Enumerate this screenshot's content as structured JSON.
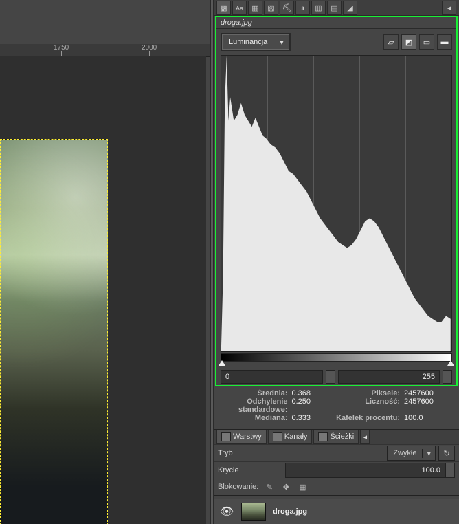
{
  "file": {
    "name": "droga.jpg"
  },
  "ruler": {
    "ticks": [
      "1750",
      "2000"
    ]
  },
  "top_tabs": [
    "brush",
    "text",
    "pattern",
    "gradient",
    "tool",
    "mask",
    "grid",
    "filter",
    "histogram"
  ],
  "histogram": {
    "channel_label": "Luminancja",
    "range_min": "0",
    "range_max": "255",
    "stats": {
      "mean_label": "Średnia:",
      "mean": "0.368",
      "std_label": "Odchylenie standardowe:",
      "std": "0.250",
      "median_label": "Mediana:",
      "median": "0.333",
      "pixels_label": "Piksele:",
      "pixels": "2457600",
      "count_label": "Liczność:",
      "count": "2457600",
      "tilepct_label": "Kafelek procentu:",
      "tilepct": "100.0"
    }
  },
  "mid_tabs": {
    "layers": "Warstwy",
    "channels": "Kanały",
    "paths": "Ścieżki"
  },
  "props": {
    "mode_label": "Tryb",
    "mode_value": "Zwykłe",
    "opacity_label": "Krycie",
    "opacity_value": "100.0",
    "lock_label": "Blokowanie:"
  },
  "layer": {
    "name": "droga.jpg"
  },
  "chart_data": {
    "type": "area",
    "title": "Luminancja",
    "xlabel": "",
    "ylabel": "",
    "xlim": [
      0,
      255
    ],
    "ylim": [
      0,
      1
    ],
    "x": [
      0,
      2,
      4,
      6,
      8,
      10,
      12,
      14,
      18,
      22,
      26,
      30,
      34,
      38,
      42,
      46,
      50,
      55,
      60,
      65,
      70,
      75,
      80,
      85,
      90,
      95,
      100,
      105,
      110,
      115,
      120,
      125,
      130,
      135,
      140,
      145,
      150,
      155,
      160,
      165,
      170,
      175,
      180,
      185,
      190,
      195,
      200,
      205,
      210,
      215,
      220,
      225,
      230,
      235,
      240,
      245,
      250,
      255
    ],
    "values": [
      0.02,
      0.25,
      0.85,
      1.0,
      0.78,
      0.86,
      0.82,
      0.78,
      0.8,
      0.84,
      0.8,
      0.78,
      0.76,
      0.79,
      0.76,
      0.73,
      0.72,
      0.7,
      0.69,
      0.67,
      0.64,
      0.61,
      0.6,
      0.58,
      0.56,
      0.54,
      0.51,
      0.48,
      0.45,
      0.43,
      0.41,
      0.39,
      0.37,
      0.36,
      0.35,
      0.36,
      0.38,
      0.41,
      0.44,
      0.45,
      0.44,
      0.42,
      0.39,
      0.36,
      0.33,
      0.3,
      0.27,
      0.24,
      0.21,
      0.18,
      0.16,
      0.14,
      0.12,
      0.11,
      0.1,
      0.1,
      0.12,
      0.11
    ]
  }
}
